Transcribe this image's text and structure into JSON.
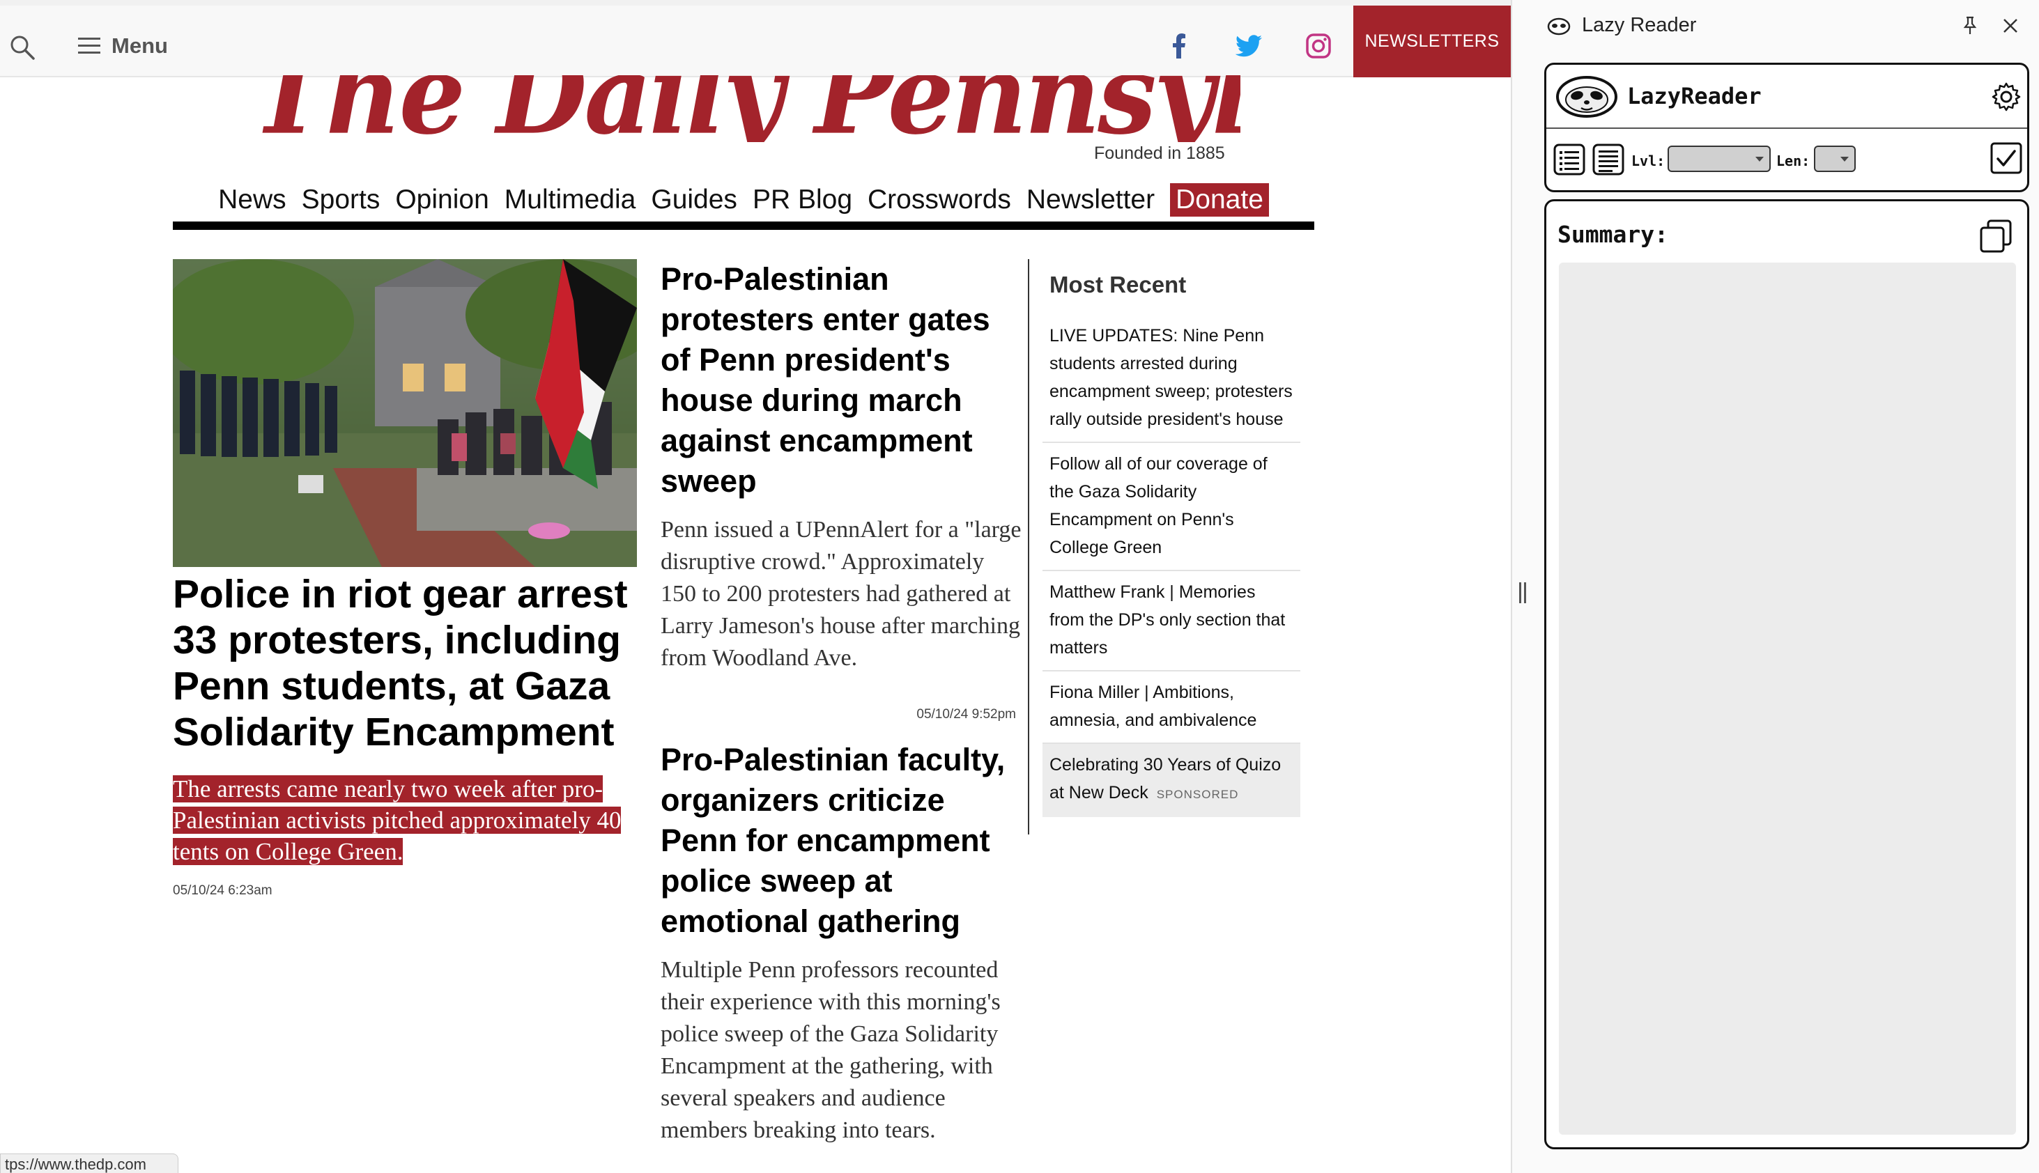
{
  "site": {
    "menu_label": "Menu",
    "newsletters_label": "NEWSLETTERS",
    "masthead_title": "The Daily Pennsylvanian",
    "founded": "Founded in 1885",
    "nav": [
      "News",
      "Sports",
      "Opinion",
      "Multimedia",
      "Guides",
      "PR Blog",
      "Crosswords",
      "Newsletter"
    ],
    "donate_label": "Donate",
    "colors": {
      "brand_red": "#a3232b",
      "facebook": "#3b5998",
      "twitter": "#1da1f2",
      "instagram": "#c13584"
    },
    "icons": [
      "search-icon",
      "hamburger-icon",
      "facebook-icon",
      "twitter-icon",
      "instagram-icon"
    ]
  },
  "lead": {
    "headline": "Police in riot gear arrest 33 protesters, including Penn students, at Gaza Solidarity Encampment",
    "dek": "The arrests came nearly two week after pro-Palestinian activists pitched approximately 40 tents on College Green.",
    "timestamp": "05/10/24 6:23am"
  },
  "middle": [
    {
      "headline": "Pro-Palestinian protesters enter gates of Penn president's house during march against encampment sweep",
      "summary": "Penn issued a UPennAlert for a \"large disruptive crowd.\" Approximately 150 to 200 protesters had gathered at Larry Jameson's house after marching from Woodland Ave.",
      "timestamp": "05/10/24 9:52pm"
    },
    {
      "headline": "Pro-Palestinian faculty, organizers criticize Penn for encampment police sweep at emotional gathering",
      "summary": "Multiple Penn professors recounted their experience with this morning's police sweep of the Gaza Solidarity Encampment at the gathering, with several speakers and audience members breaking into tears."
    }
  ],
  "most_recent": {
    "title": "Most Recent",
    "items": [
      "LIVE UPDATES: Nine Penn students arrested during encampment sweep; protesters rally outside president's house",
      "Follow all of our coverage of the Gaza Solidarity Encampment on Penn's College Green",
      "Matthew Frank | Memories from the DP's only section that matters",
      "Fiona Miller | Ambitions, amnesia, and ambivalence"
    ],
    "sponsored_item": "Celebrating 30 Years of Quizo at New Deck",
    "sponsored_tag": "SPONSORED"
  },
  "status_url": "tps://www.thedp.com",
  "side_panel": {
    "title": "Lazy Reader",
    "app_name": "LazyReader",
    "lvl_label": "Lvl:",
    "len_label": "Len:",
    "summary_label": "Summary:",
    "icons": [
      "sloth-logo-icon",
      "pin-icon",
      "close-icon",
      "gear-icon",
      "list-icon",
      "paragraph-icon",
      "check-icon",
      "copy-icon"
    ]
  }
}
